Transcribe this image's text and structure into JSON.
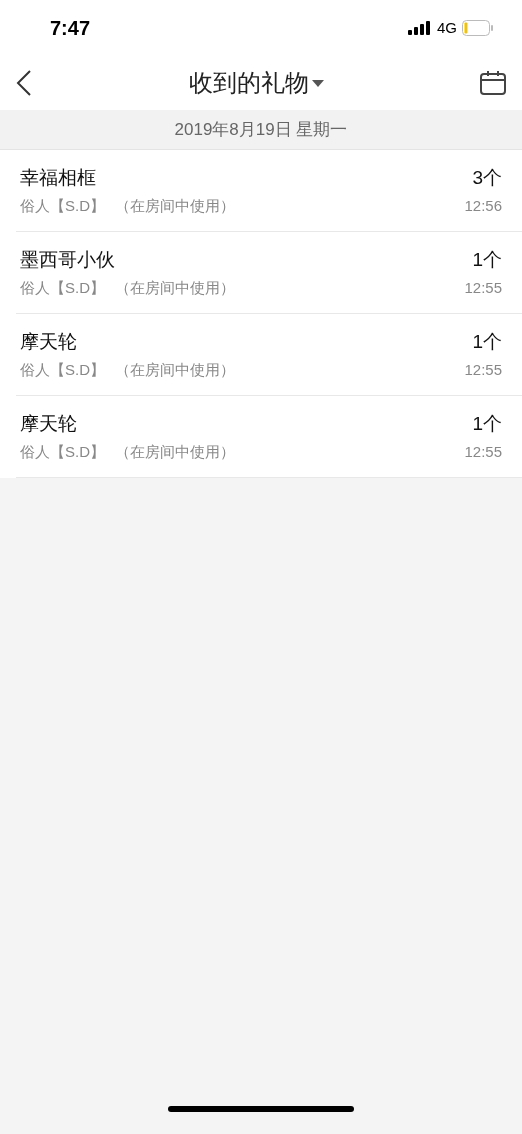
{
  "status_bar": {
    "time": "7:47",
    "network": "4G"
  },
  "nav": {
    "title": "收到的礼物"
  },
  "date_header": "2019年8月19日 星期一",
  "gifts": [
    {
      "name": "幸福相框",
      "sender": "俗人【S.D】",
      "note": "（在房间中使用）",
      "count": "3个",
      "time": "12:56"
    },
    {
      "name": "墨西哥小伙",
      "sender": "俗人【S.D】",
      "note": "（在房间中使用）",
      "count": "1个",
      "time": "12:55"
    },
    {
      "name": "摩天轮",
      "sender": "俗人【S.D】",
      "note": "（在房间中使用）",
      "count": "1个",
      "time": "12:55"
    },
    {
      "name": "摩天轮",
      "sender": "俗人【S.D】",
      "note": "（在房间中使用）",
      "count": "1个",
      "time": "12:55"
    }
  ]
}
